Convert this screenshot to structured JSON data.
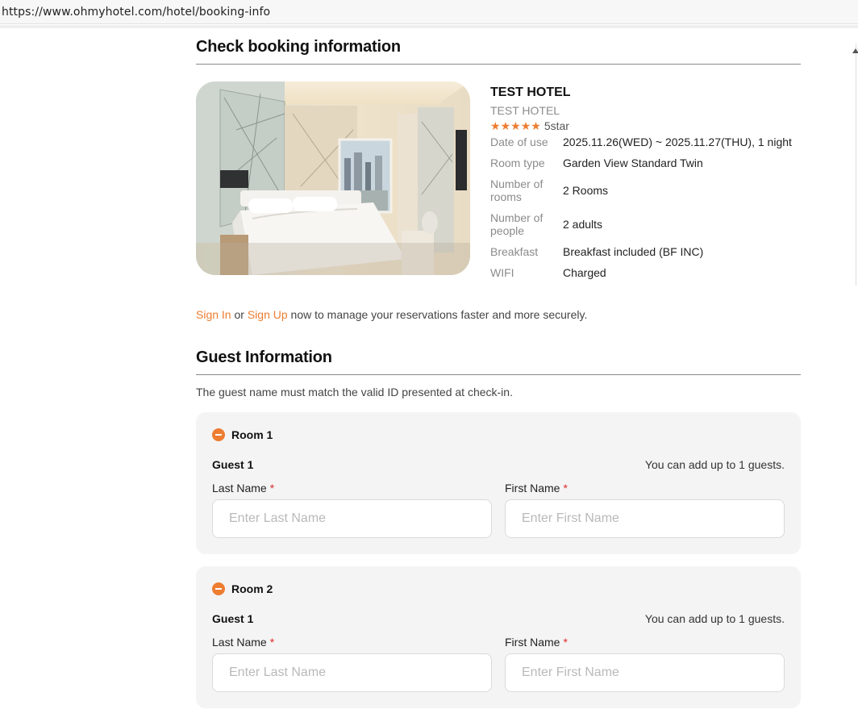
{
  "browser": {
    "url": "https://www.ohmyhotel.com/hotel/booking-info"
  },
  "booking": {
    "title": "Check booking information",
    "hotel_name": "TEST HOTEL",
    "hotel_subname": "TEST HOTEL",
    "rating_stars": 5,
    "rating_label": "5star",
    "star_color": "#ed7d31",
    "details": [
      {
        "label": "Date of use",
        "value": "2025.11.26(WED) ~ 2025.11.27(THU), 1 night"
      },
      {
        "label": "Room type",
        "value": "Garden View Standard Twin"
      },
      {
        "label": "Number of rooms",
        "value": "2 Rooms"
      },
      {
        "label": "Number of people",
        "value": "2 adults"
      },
      {
        "label": "Breakfast",
        "value": "Breakfast included (BF INC)"
      },
      {
        "label": "WIFI",
        "value": "Charged"
      }
    ]
  },
  "signin": {
    "sign_in_link": "Sign In",
    "or_text": " or ",
    "sign_up_link": "Sign Up",
    "suffix": " now to manage your reservations faster and more securely.",
    "link_color": "#ed7d31"
  },
  "guest": {
    "title": "Guest Information",
    "note": "The guest name must match the valid ID presented at check-in.",
    "rooms": [
      {
        "title": "Room 1",
        "guest_title": "Guest 1",
        "limit_text": "You can add up to 1 guests.",
        "last_name_label": "Last Name",
        "first_name_label": "First Name",
        "required_mark": "*",
        "last_name_placeholder": "Enter Last Name",
        "first_name_placeholder": "Enter First Name",
        "last_name_value": "",
        "first_name_value": ""
      },
      {
        "title": "Room 2",
        "guest_title": "Guest 1",
        "limit_text": "You can add up to 1 guests.",
        "last_name_label": "Last Name",
        "first_name_label": "First Name",
        "required_mark": "*",
        "last_name_placeholder": "Enter Last Name",
        "first_name_placeholder": "Enter First Name",
        "last_name_value": "",
        "first_name_value": ""
      }
    ]
  },
  "colors": {
    "accent": "#ed7d31",
    "required": "#e0292e",
    "card_bg": "#f4f4f4"
  }
}
